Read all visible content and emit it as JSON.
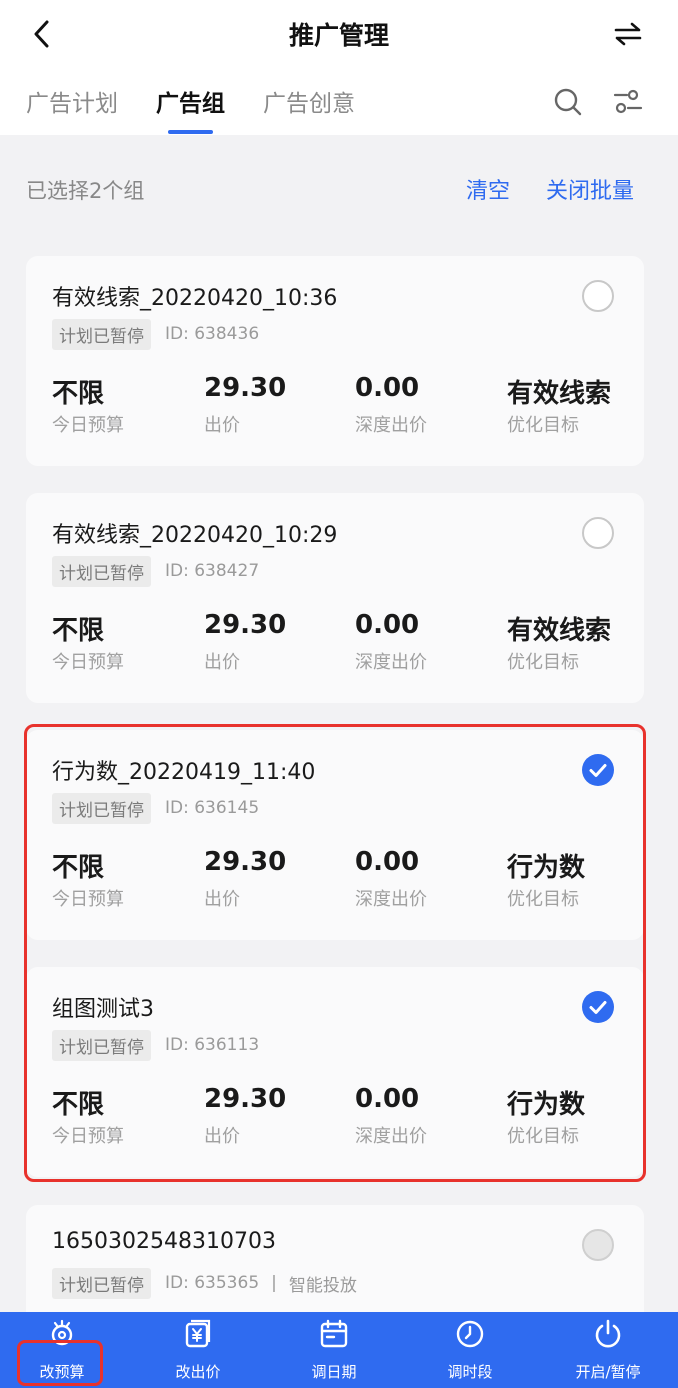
{
  "header": {
    "title": "推广管理",
    "back_icon": "chevron-left-icon",
    "swap_icon": "swap-arrows-icon"
  },
  "tabs": [
    {
      "label": "广告计划",
      "active": false
    },
    {
      "label": "广告组",
      "active": true
    },
    {
      "label": "广告创意",
      "active": false
    }
  ],
  "toolbar": {
    "search_icon": "search-icon",
    "filter_icon": "filter-icon"
  },
  "selection": {
    "count_text": "已选择2个组",
    "clear_label": "清空",
    "close_batch_label": "关闭批量"
  },
  "labels": {
    "budget": "今日预算",
    "bid": "出价",
    "deep_bid": "深度出价",
    "goal": "优化目标"
  },
  "cards": [
    {
      "title": "有效线索_20220420_10:36",
      "status": "计划已暂停",
      "id": "ID:  638436",
      "checked": false,
      "budget": "不限",
      "bid": "29.30",
      "deep_bid": "0.00",
      "goal": "有效线索"
    },
    {
      "title": "有效线索_20220420_10:29",
      "status": "计划已暂停",
      "id": "ID:  638427",
      "checked": false,
      "budget": "不限",
      "bid": "29.30",
      "deep_bid": "0.00",
      "goal": "有效线索"
    },
    {
      "title": "行为数_20220419_11:40",
      "status": "计划已暂停",
      "id": "ID:  636145",
      "checked": true,
      "budget": "不限",
      "bid": "29.30",
      "deep_bid": "0.00",
      "goal": "行为数"
    },
    {
      "title": "组图测试3",
      "status": "计划已暂停",
      "id": "ID:  636113",
      "checked": true,
      "budget": "不限",
      "bid": "29.30",
      "deep_bid": "0.00",
      "goal": "行为数"
    },
    {
      "title": "1650302548310703",
      "status": "计划已暂停",
      "id": "ID:  635365",
      "separator": "|",
      "extra": "智能投放",
      "checked": false,
      "disabled": true
    }
  ],
  "bottom_bar": [
    {
      "label": "改预算",
      "icon": "budget-gear-icon"
    },
    {
      "label": "改出价",
      "icon": "bid-yen-icon"
    },
    {
      "label": "调日期",
      "icon": "calendar-icon"
    },
    {
      "label": "调时段",
      "icon": "clock-icon"
    },
    {
      "label": "开启/暂停",
      "icon": "power-icon"
    }
  ],
  "colors": {
    "accent": "#2f6bf0",
    "highlight": "#e8322c"
  }
}
